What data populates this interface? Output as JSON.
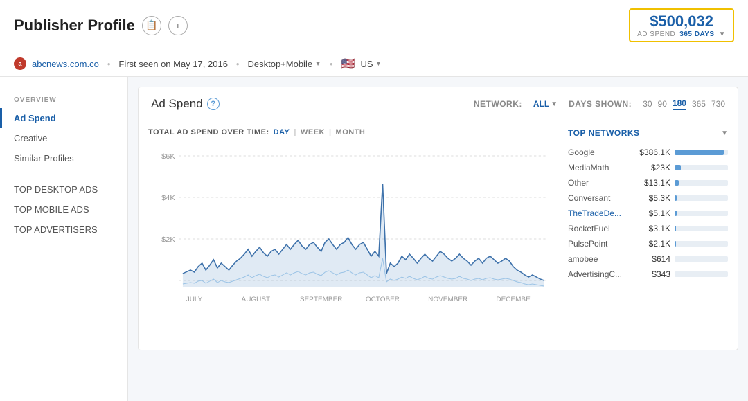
{
  "header": {
    "title": "Publisher Profile",
    "copy_icon": "📋",
    "plus_icon": "+",
    "ad_spend_amount": "$500,032",
    "ad_spend_label": "AD SPEND",
    "ad_spend_days": "365 DAYS"
  },
  "sub_header": {
    "domain": "abcnews.com.co",
    "first_seen": "First seen on May 17, 2016",
    "platform": "Desktop+Mobile",
    "region": "US"
  },
  "sidebar": {
    "overview_label": "OVERVIEW",
    "items": [
      {
        "id": "ad-spend",
        "label": "Ad Spend",
        "active": true
      },
      {
        "id": "creative",
        "label": "Creative",
        "active": false
      },
      {
        "id": "similar-profiles",
        "label": "Similar Profiles",
        "active": false
      }
    ],
    "sections": [
      {
        "id": "top-desktop-ads",
        "label": "TOP DESKTOP ADS"
      },
      {
        "id": "top-mobile-ads",
        "label": "TOP MOBILE ADS"
      },
      {
        "id": "top-advertisers",
        "label": "TOP ADVERTISERS"
      }
    ]
  },
  "card": {
    "title": "Ad Spend",
    "help": "?",
    "network_label": "NETWORK:",
    "network_value": "ALL",
    "days_label": "DAYS SHOWN:",
    "days_options": [
      {
        "value": "30",
        "active": false
      },
      {
        "value": "90",
        "active": false
      },
      {
        "value": "180",
        "active": true
      },
      {
        "value": "365",
        "active": false
      },
      {
        "value": "730",
        "active": false
      }
    ]
  },
  "time_controls": {
    "label": "TOTAL AD SPEND OVER TIME:",
    "options": [
      {
        "value": "DAY",
        "active": true
      },
      {
        "value": "WEEK",
        "active": false
      },
      {
        "value": "MONTH",
        "active": false
      }
    ]
  },
  "chart": {
    "y_labels": [
      "$6K",
      "$4K",
      "$2K"
    ],
    "x_labels": [
      "JULY",
      "AUGUST",
      "SEPTEMBER",
      "OCTOBER",
      "NOVEMBER",
      "DECEMBE"
    ]
  },
  "top_networks": {
    "label": "TOP NETWORKS",
    "rows": [
      {
        "name": "Google",
        "amount": "$386.1K",
        "bar_pct": 92,
        "link": false
      },
      {
        "name": "MediaMath",
        "amount": "$23K",
        "bar_pct": 12,
        "link": false
      },
      {
        "name": "Other",
        "amount": "$13.1K",
        "bar_pct": 8,
        "link": false
      },
      {
        "name": "Conversant",
        "amount": "$5.3K",
        "bar_pct": 4,
        "link": false
      },
      {
        "name": "TheTradeDe...",
        "amount": "$5.1K",
        "bar_pct": 4,
        "link": true
      },
      {
        "name": "RocketFuel",
        "amount": "$3.1K",
        "bar_pct": 3,
        "link": false
      },
      {
        "name": "PulsePoint",
        "amount": "$2.1K",
        "bar_pct": 2,
        "link": false
      },
      {
        "name": "amobee",
        "amount": "$614",
        "bar_pct": 1,
        "link": false
      },
      {
        "name": "AdvertisingC...",
        "amount": "$343",
        "bar_pct": 1,
        "link": false
      }
    ]
  }
}
